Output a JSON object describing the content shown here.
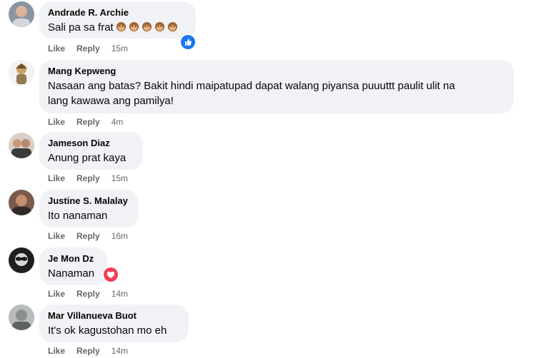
{
  "comments": [
    {
      "author": "Andrade R. Archie",
      "text": "Sali pa sa frat",
      "emoji_count": 5,
      "emoji": "monkey-face-emoji",
      "like_label": "Like",
      "reply_label": "Reply",
      "time": "15m",
      "reaction": "like-reaction-icon",
      "avatar": "avatar-photo-1"
    },
    {
      "author": "Mang Kepweng",
      "text_line1": "Nasaan ang batas? Bakit hindi maipatupad dapat walang piyansa puuuttt paulit ulit na",
      "text_line2": "lang kawawa ang pamilya!",
      "like_label": "Like",
      "reply_label": "Reply",
      "time": "4m",
      "avatar": "avatar-photo-2"
    },
    {
      "author": "Jameson Diaz",
      "text": "Anung prat kaya",
      "like_label": "Like",
      "reply_label": "Reply",
      "time": "15m",
      "avatar": "avatar-photo-3"
    },
    {
      "author": "Justine S. Malalay",
      "text": "Ito nanaman",
      "like_label": "Like",
      "reply_label": "Reply",
      "time": "16m",
      "avatar": "avatar-photo-4"
    },
    {
      "author": "Je Mon Dz",
      "text": "Nanaman",
      "like_label": "Like",
      "reply_label": "Reply",
      "time": "14m",
      "reaction": "love-reaction-icon",
      "avatar": "avatar-photo-5"
    },
    {
      "author": "Mar Villanueva Buot",
      "text": "It's ok kagustohan mo eh",
      "like_label": "Like",
      "reply_label": "Reply",
      "time": "14m",
      "avatar": "avatar-photo-6"
    }
  ],
  "colors": {
    "bubble": "#f0f2f5",
    "meta_text": "#65676b",
    "like_blue": "#1877f2",
    "love_red": "#f33e58"
  }
}
